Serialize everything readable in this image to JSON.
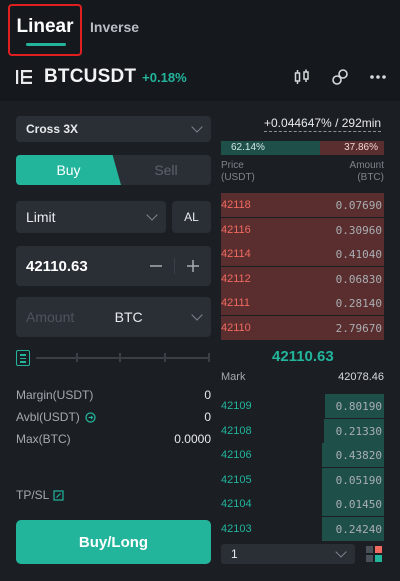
{
  "tabs": {
    "linear": "Linear",
    "inverse": "Inverse"
  },
  "symbol": {
    "name": "BTCUSDT",
    "change": "+0.18%"
  },
  "form": {
    "margin_mode": "Cross 3X",
    "buy_label": "Buy",
    "sell_label": "Sell",
    "order_type": "Limit",
    "al_label": "AL",
    "price_value": "42110.63",
    "amount_placeholder": "Amount",
    "amount_unit": "BTC",
    "margin_label": "Margin(USDT)",
    "margin_value": "0",
    "avbl_label": "Avbl(USDT)",
    "avbl_value": "0",
    "max_label": "Max(BTC)",
    "max_value": "0.0000",
    "tpsl_label": "TP/SL",
    "submit_label": "Buy/Long"
  },
  "book": {
    "funding": "+0.044647% / 292min",
    "buy_ratio": "62.14%",
    "sell_ratio": "37.86%",
    "price_header": "Price",
    "price_unit": "(USDT)",
    "amount_header": "Amount",
    "amount_unit": "(BTC)",
    "asks": [
      {
        "price": "42118",
        "amount": "0.07690",
        "depth": 1.0
      },
      {
        "price": "42116",
        "amount": "0.30960",
        "depth": 1.0
      },
      {
        "price": "42114",
        "amount": "0.41040",
        "depth": 1.0
      },
      {
        "price": "42112",
        "amount": "0.06830",
        "depth": 1.0
      },
      {
        "price": "42111",
        "amount": "0.28140",
        "depth": 1.0
      },
      {
        "price": "42110",
        "amount": "2.79670",
        "depth": 1.0
      }
    ],
    "last_price": "42110.63",
    "mark_label": "Mark",
    "mark_value": "42078.46",
    "bids": [
      {
        "price": "42109",
        "amount": "0.80190",
        "depth": 0.36
      },
      {
        "price": "42108",
        "amount": "0.21330",
        "depth": 0.37
      },
      {
        "price": "42106",
        "amount": "0.43820",
        "depth": 0.38
      },
      {
        "price": "42105",
        "amount": "0.05190",
        "depth": 0.38
      },
      {
        "price": "42104",
        "amount": "0.01450",
        "depth": 0.38
      },
      {
        "price": "42103",
        "amount": "0.24240",
        "depth": 0.38
      }
    ],
    "depth_step": "1"
  },
  "colors": {
    "accent": "#22b59c",
    "sell": "#f06a60",
    "highlight": "#e02020"
  }
}
